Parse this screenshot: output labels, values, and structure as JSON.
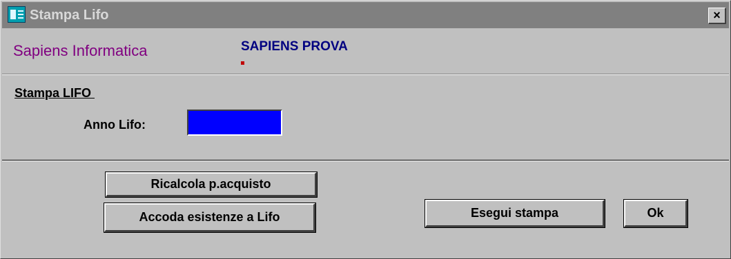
{
  "window": {
    "title": "Stampa Lifo",
    "close_label": "×"
  },
  "header": {
    "company": "Sapiens Informatica",
    "user": "SAPIENS PROVA"
  },
  "section": {
    "title": "Stampa LIFO "
  },
  "form": {
    "anno_label": "Anno Lifo:",
    "anno_value": ""
  },
  "buttons": {
    "ricalcola": "Ricalcola p.acquisto",
    "accoda": "Accoda esistenze a Lifo",
    "esegui": "Esegui stampa",
    "ok": "Ok"
  },
  "colors": {
    "title_bar": "#808080",
    "company_text": "#800080",
    "user_text": "#000080",
    "input_bg": "#0000ff",
    "window_bg": "#c0c0c0"
  },
  "icons": {
    "app": "app-window-icon",
    "close": "close-icon"
  }
}
